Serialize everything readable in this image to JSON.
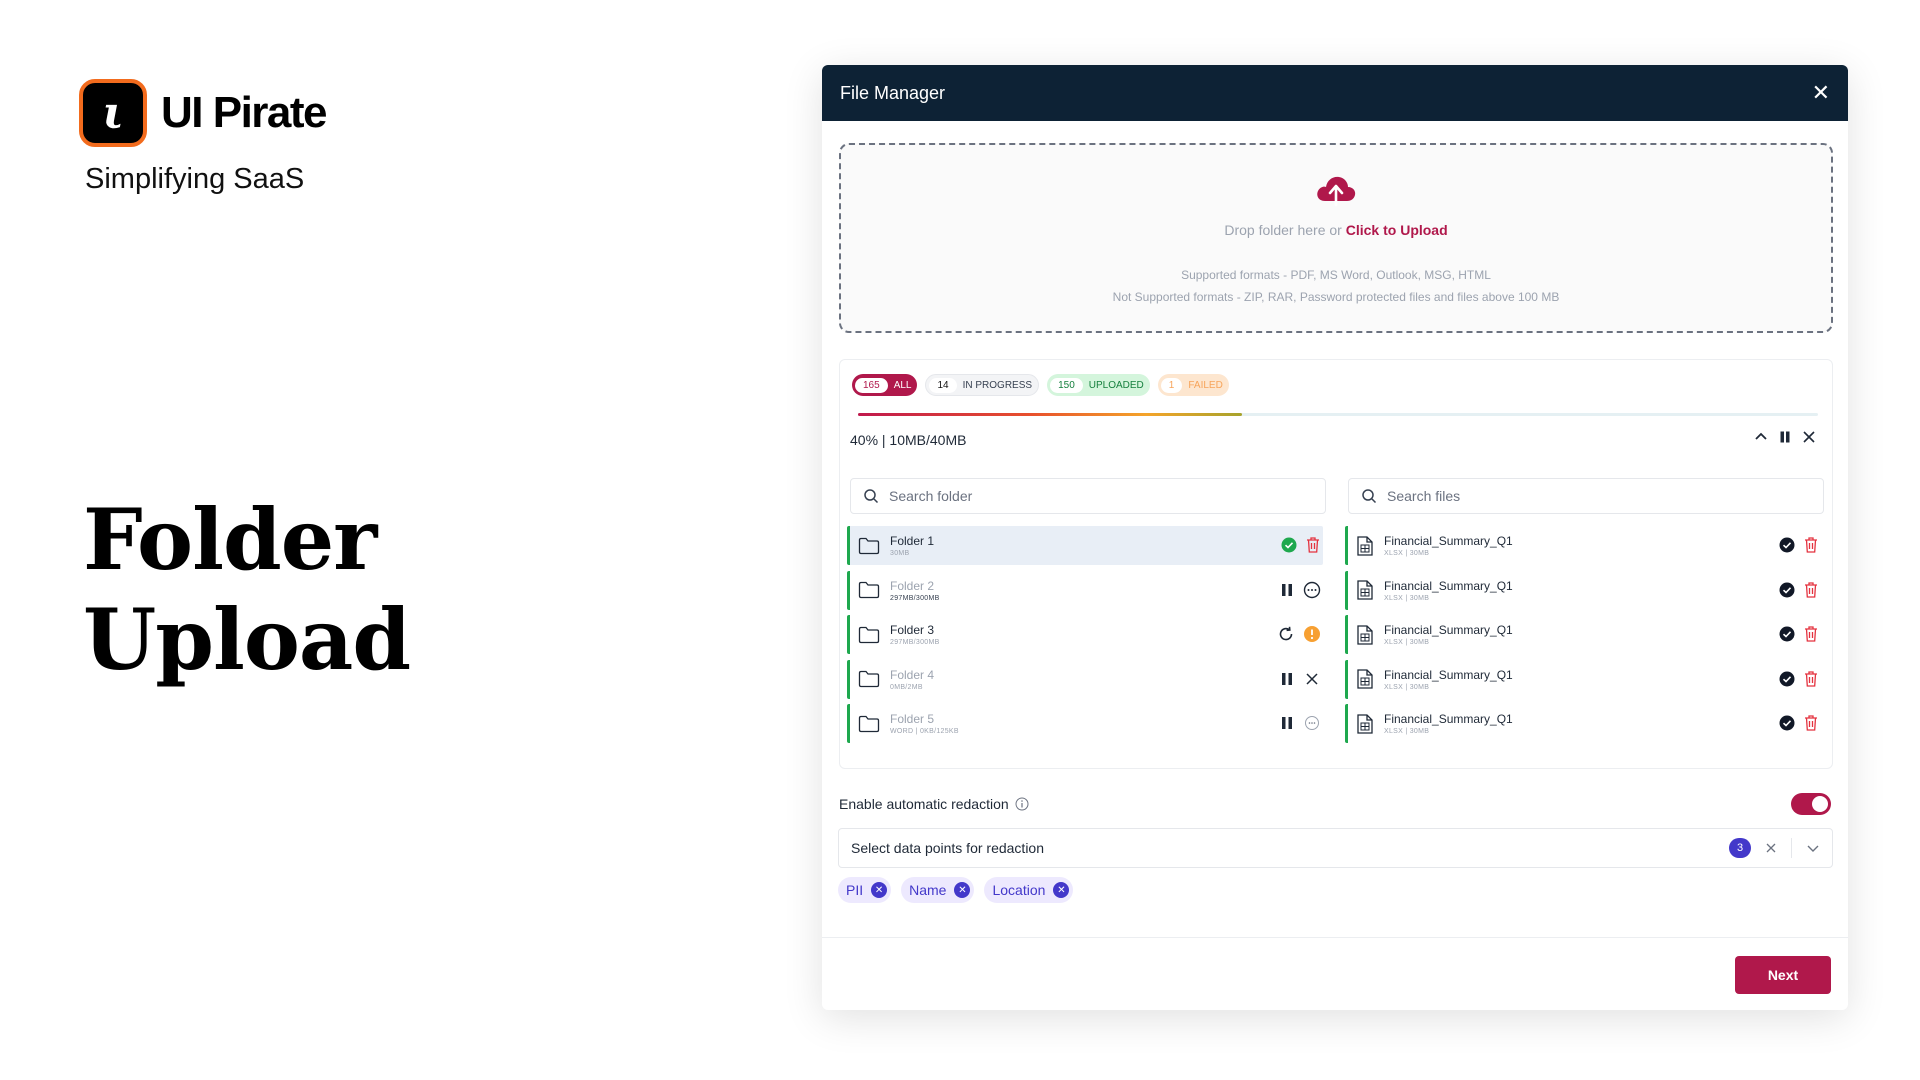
{
  "brand": {
    "logo_glyph": "ι",
    "name": "UI Pirate",
    "tagline": "Simplifying SaaS"
  },
  "hero": {
    "line1": "Folder",
    "line2": "Upload"
  },
  "dialog": {
    "title": "File Manager",
    "close_glyph": "✕",
    "dropzone": {
      "text": "Drop  folder here or ",
      "link": "Click to Upload",
      "supported": "Supported formats - PDF, MS Word, Outlook, MSG, HTML",
      "not_supported": "Not Supported formats - ZIP, RAR, Password protected files and files above 100 MB"
    },
    "filters": [
      {
        "count": "165",
        "label": "ALL"
      },
      {
        "count": "14",
        "label": "IN PROGRESS"
      },
      {
        "count": "150",
        "label": "UPLOADED"
      },
      {
        "count": "1",
        "label": "FAILED"
      }
    ],
    "progress": {
      "percent": 40,
      "text": "40% | 10MB/40MB"
    },
    "folder_search": {
      "placeholder": "Search folder"
    },
    "file_search": {
      "placeholder": "Search files"
    },
    "folders": [
      {
        "name": "Folder 1",
        "sub": "30MB",
        "status": "uploaded"
      },
      {
        "name": "Folder 2",
        "sub": "297MB/300MB",
        "status": "in-progress"
      },
      {
        "name": "Folder 3",
        "sub": "297MB/300MB",
        "status": "failed"
      },
      {
        "name": "Folder 4",
        "sub": "0MB/2MB",
        "status": "paused"
      },
      {
        "name": "Folder 5",
        "sub": "WORD | 0KB/125KB",
        "status": "queued"
      }
    ],
    "files": [
      {
        "name": "Financial_Summary_Q1",
        "sub": "XLSX | 30MB"
      },
      {
        "name": "Financial_Summary_Q1",
        "sub": "XLSX | 30MB"
      },
      {
        "name": "Financial_Summary_Q1",
        "sub": "XLSX | 30MB"
      },
      {
        "name": "Financial_Summary_Q1",
        "sub": "XLSX | 30MB"
      },
      {
        "name": "Financial_Summary_Q1",
        "sub": "XLSX | 30MB"
      }
    ],
    "redaction": {
      "label": "Enable automatic redaction",
      "enabled": true,
      "select_label": "Select data points for redaction",
      "selected_count": "3",
      "tags": [
        "PII",
        "Name",
        "Location"
      ]
    },
    "next_label": "Next"
  },
  "colors": {
    "brand": "#b0184b",
    "header": "#0d2235",
    "success": "#1ea84e",
    "danger": "#e4323f",
    "warning": "#f7a032",
    "tag": "#4338ca"
  }
}
